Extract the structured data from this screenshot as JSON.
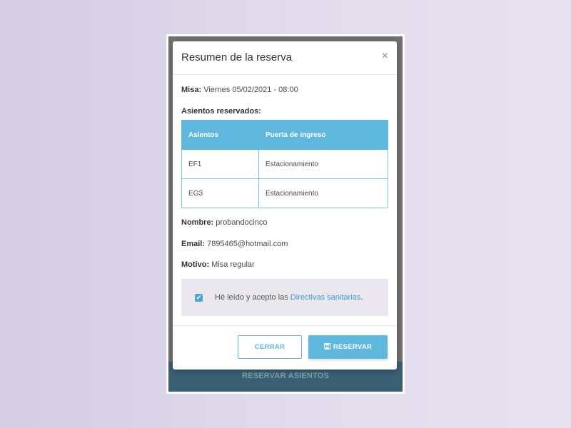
{
  "background_page": {
    "bottom_button_label": "RESERVAR ASIENTOS"
  },
  "modal": {
    "title": "Resumen de la reserva",
    "close_symbol": "×",
    "misa_label": "Misa:",
    "misa_value": "Viernes 05/02/2021 - 08:00",
    "seats_heading": "Asientos reservados:",
    "table": {
      "headers": [
        "Asientos",
        "Puerta de ingreso"
      ],
      "rows": [
        [
          "EF1",
          "Estacionamiento"
        ],
        [
          "EG3",
          "Estacionamiento"
        ]
      ]
    },
    "nombre_label": "Nombre:",
    "nombre_value": "probandocinco",
    "email_label": "Email:",
    "email_value": "7895465@hotmail.com",
    "motivo_label": "Motivo:",
    "motivo_value": "Misa regular",
    "consent": {
      "checked": true,
      "check_glyph": "✔",
      "text": "Hé leído y acepto las ",
      "link_text": "Directivas sanitarias",
      "suffix": "."
    },
    "buttons": {
      "close_label": "CERRAR",
      "reserve_label": "RESERVAR",
      "reserve_icon": "save-icon"
    }
  },
  "colors": {
    "accent": "#5fb7de",
    "overlay_bar": "#3a5f73",
    "consent_bg": "#ebe7ee"
  }
}
